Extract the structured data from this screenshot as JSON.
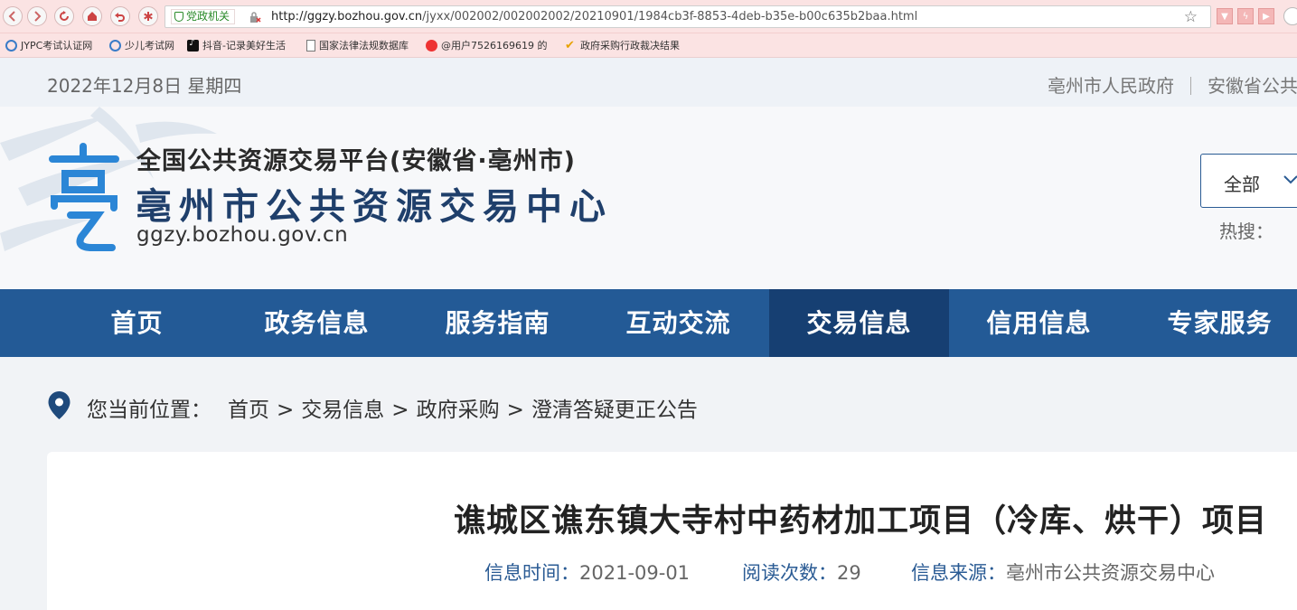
{
  "browser": {
    "cert_label": "党政机关",
    "url_host": "http://ggzy.bozhou.gov.cn",
    "url_path": "/jyxx/002002/002002002/20210901/1984cb3f-8853-4deb-b35e-b00c635b2baa.html",
    "bookmarks": [
      {
        "label": "JYPC考试认证网",
        "icon": "ie-icon"
      },
      {
        "label": "少儿考试网",
        "icon": "ie-icon"
      },
      {
        "label": "抖音-记录美好生活",
        "icon": "tiktok-icon"
      },
      {
        "label": "国家法律法规数据库",
        "icon": "document-icon"
      },
      {
        "label": "@用户7526169619 的",
        "icon": "weibo-icon"
      },
      {
        "label": "政府采购行政裁决结果",
        "icon": "checkmark-icon"
      }
    ]
  },
  "topbar": {
    "date": "2022年12月8日 星期四",
    "links": [
      "亳州市人民政府",
      "安徽省公共"
    ]
  },
  "header": {
    "subtitle": "全国公共资源交易平台(安徽省·亳州市)",
    "title": "亳州市公共资源交易中心",
    "domain": "ggzy.bozhou.gov.cn",
    "search_scope": "全部",
    "hot_label": "热搜："
  },
  "nav": {
    "items": [
      "首页",
      "政务信息",
      "服务指南",
      "互动交流",
      "交易信息",
      "信用信息",
      "专家服务"
    ],
    "active_index": 4
  },
  "breadcrumb": {
    "label": "您当前位置：",
    "items": [
      "首页",
      "交易信息",
      "政府采购",
      "澄清答疑更正公告"
    ],
    "separator": ">"
  },
  "article": {
    "title": "谯城区谯东镇大寺村中药材加工项目（冷库、烘干）项目",
    "time_label": "信息时间：",
    "time_value": "2021-09-01",
    "reads_label": "阅读次数：",
    "reads_value": "29",
    "source_label": "信息来源：",
    "source_value": "亳州市公共资源交易中心"
  },
  "colors": {
    "nav_bg": "#235a96",
    "nav_active": "#163f72",
    "title_blue": "#1f3f6b",
    "browser_tint": "#fbe3e3"
  }
}
